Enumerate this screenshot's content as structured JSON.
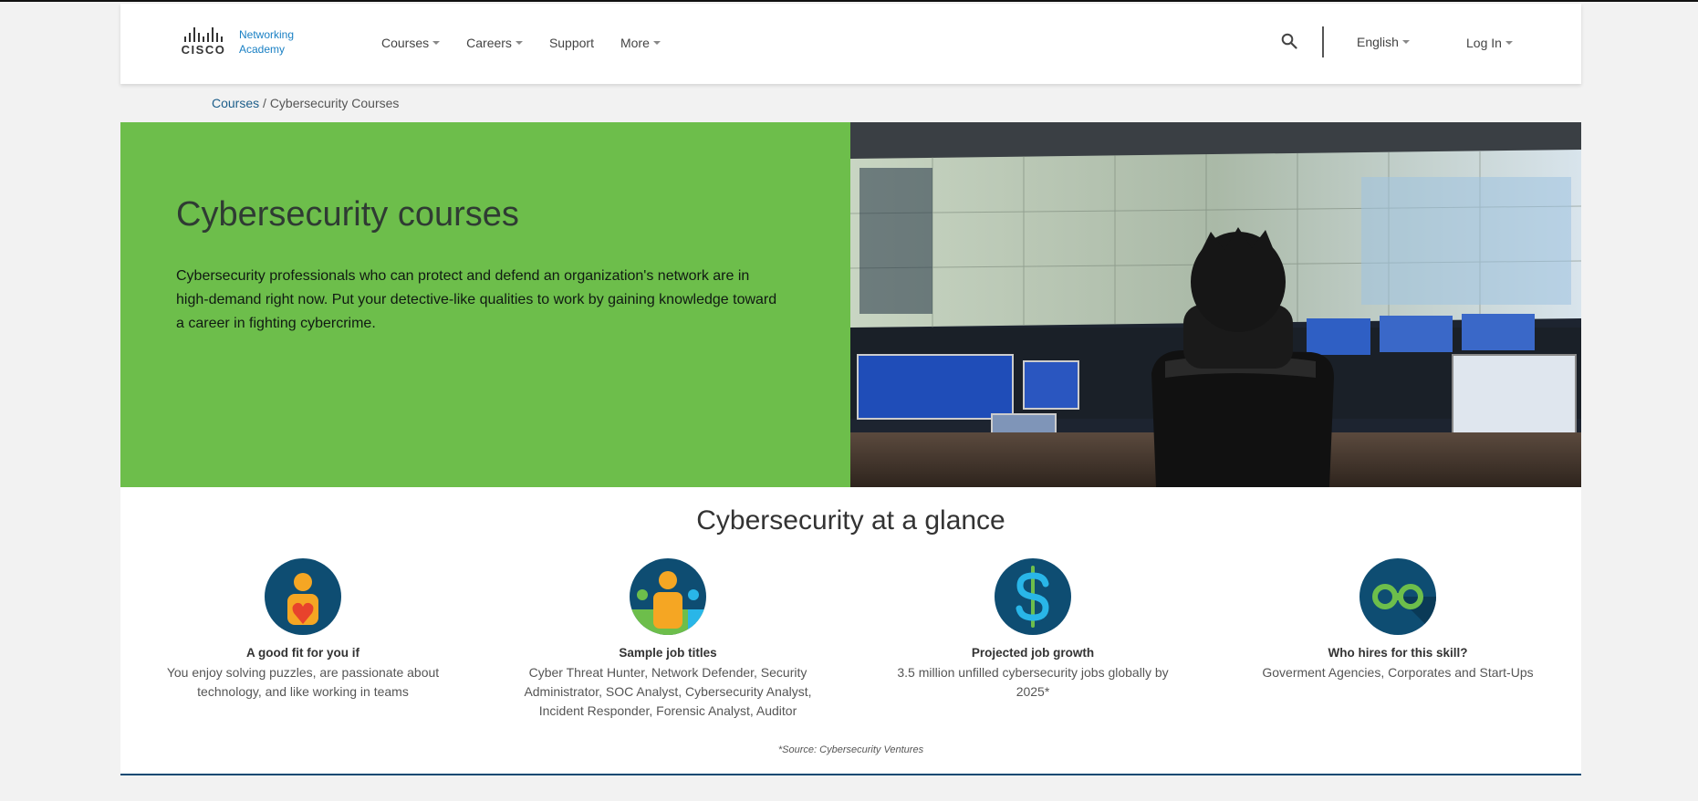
{
  "header": {
    "logo_word": "CISCO",
    "logo_line1": "Networking",
    "logo_line2": "Academy",
    "nav": [
      {
        "label": "Courses",
        "dropdown": true
      },
      {
        "label": "Careers",
        "dropdown": true
      },
      {
        "label": "Support",
        "dropdown": false
      },
      {
        "label": "More",
        "dropdown": true
      }
    ],
    "search_icon": "search-icon",
    "language": "English",
    "login": "Log In"
  },
  "breadcrumb": {
    "link": "Courses",
    "separator": " / ",
    "current": "Cybersecurity Courses"
  },
  "hero": {
    "title": "Cybersecurity courses",
    "text": "Cybersecurity professionals who can protect and defend an organization's network are in high-demand right now. Put your detective-like qualities to work by gaining knowledge toward a career in fighting cybercrime.",
    "bg_color": "#6dbe4b"
  },
  "glance": {
    "title": "Cybersecurity at a glance",
    "items": [
      {
        "icon": "person-heart-icon",
        "heading": "A good fit for you if",
        "text": "You enjoy solving puzzles, are passionate about technology, and like working in teams"
      },
      {
        "icon": "team-icon",
        "heading": "Sample job titles",
        "text": "Cyber Threat Hunter, Network Defender, Security Administrator, SOC Analyst, Cybersecurity Analyst, Incident Responder, Forensic Analyst, Auditor"
      },
      {
        "icon": "dollar-icon",
        "heading": "Projected job growth",
        "text": "3.5 million unfilled cybersecurity jobs globally by 2025*"
      },
      {
        "icon": "binoculars-icon",
        "heading": "Who hires for this skill?",
        "text": "Goverment Agencies, Corporates and Start-Ups"
      }
    ],
    "source": "*Source: Cybersecurity Ventures"
  },
  "colors": {
    "brand_blue": "#1a80c4",
    "icon_navy": "#0e4d72",
    "accent_orange": "#f5a623",
    "accent_green": "#6dbe4b",
    "accent_cyan": "#29b6e8"
  }
}
